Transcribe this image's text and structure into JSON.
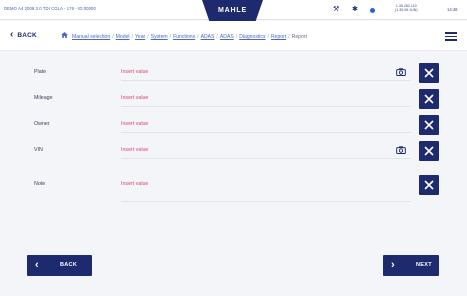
{
  "header": {
    "vehicle_info": "DEMO A4 2009 3.0 TDI CGLA - 176 - ID:00000",
    "brand": "MAHLE",
    "coordinates": "1.35.282.119\n(1.35.96.1UN)",
    "time": "14:46"
  },
  "nav": {
    "back_label": "BACK",
    "breadcrumbs": [
      {
        "label": "Manual selection"
      },
      {
        "label": "Model"
      },
      {
        "label": "Year"
      },
      {
        "label": "System"
      },
      {
        "label": "Functions"
      },
      {
        "label": "ADAS"
      },
      {
        "label": "ADAS"
      },
      {
        "label": "Diagnostics"
      },
      {
        "label": "Report"
      },
      {
        "label": "Report"
      }
    ]
  },
  "form": {
    "fields": [
      {
        "label": "Plate",
        "placeholder": "Insert value",
        "has_camera": true
      },
      {
        "label": "Mileage",
        "placeholder": "Insert value",
        "has_camera": false
      },
      {
        "label": "Owner",
        "placeholder": "Insert value",
        "has_camera": false
      },
      {
        "label": "VIN",
        "placeholder": "Insert value",
        "has_camera": true
      },
      {
        "label": "Note",
        "placeholder": "Insert value",
        "has_camera": false
      }
    ]
  },
  "footer": {
    "back_label": "BACK",
    "next_label": "NEXT"
  },
  "icons": {
    "bluetooth": "bluetooth-icon",
    "tool": "tool-icon",
    "status": "status-dot-icon",
    "home": "home-icon",
    "menu": "menu-icon",
    "camera": "camera-icon",
    "clear": "close-icon"
  },
  "colors": {
    "primary": "#1d2b6e",
    "link": "#4a68c4",
    "placeholder": "#d8476c",
    "background": "#f4f5f8"
  }
}
